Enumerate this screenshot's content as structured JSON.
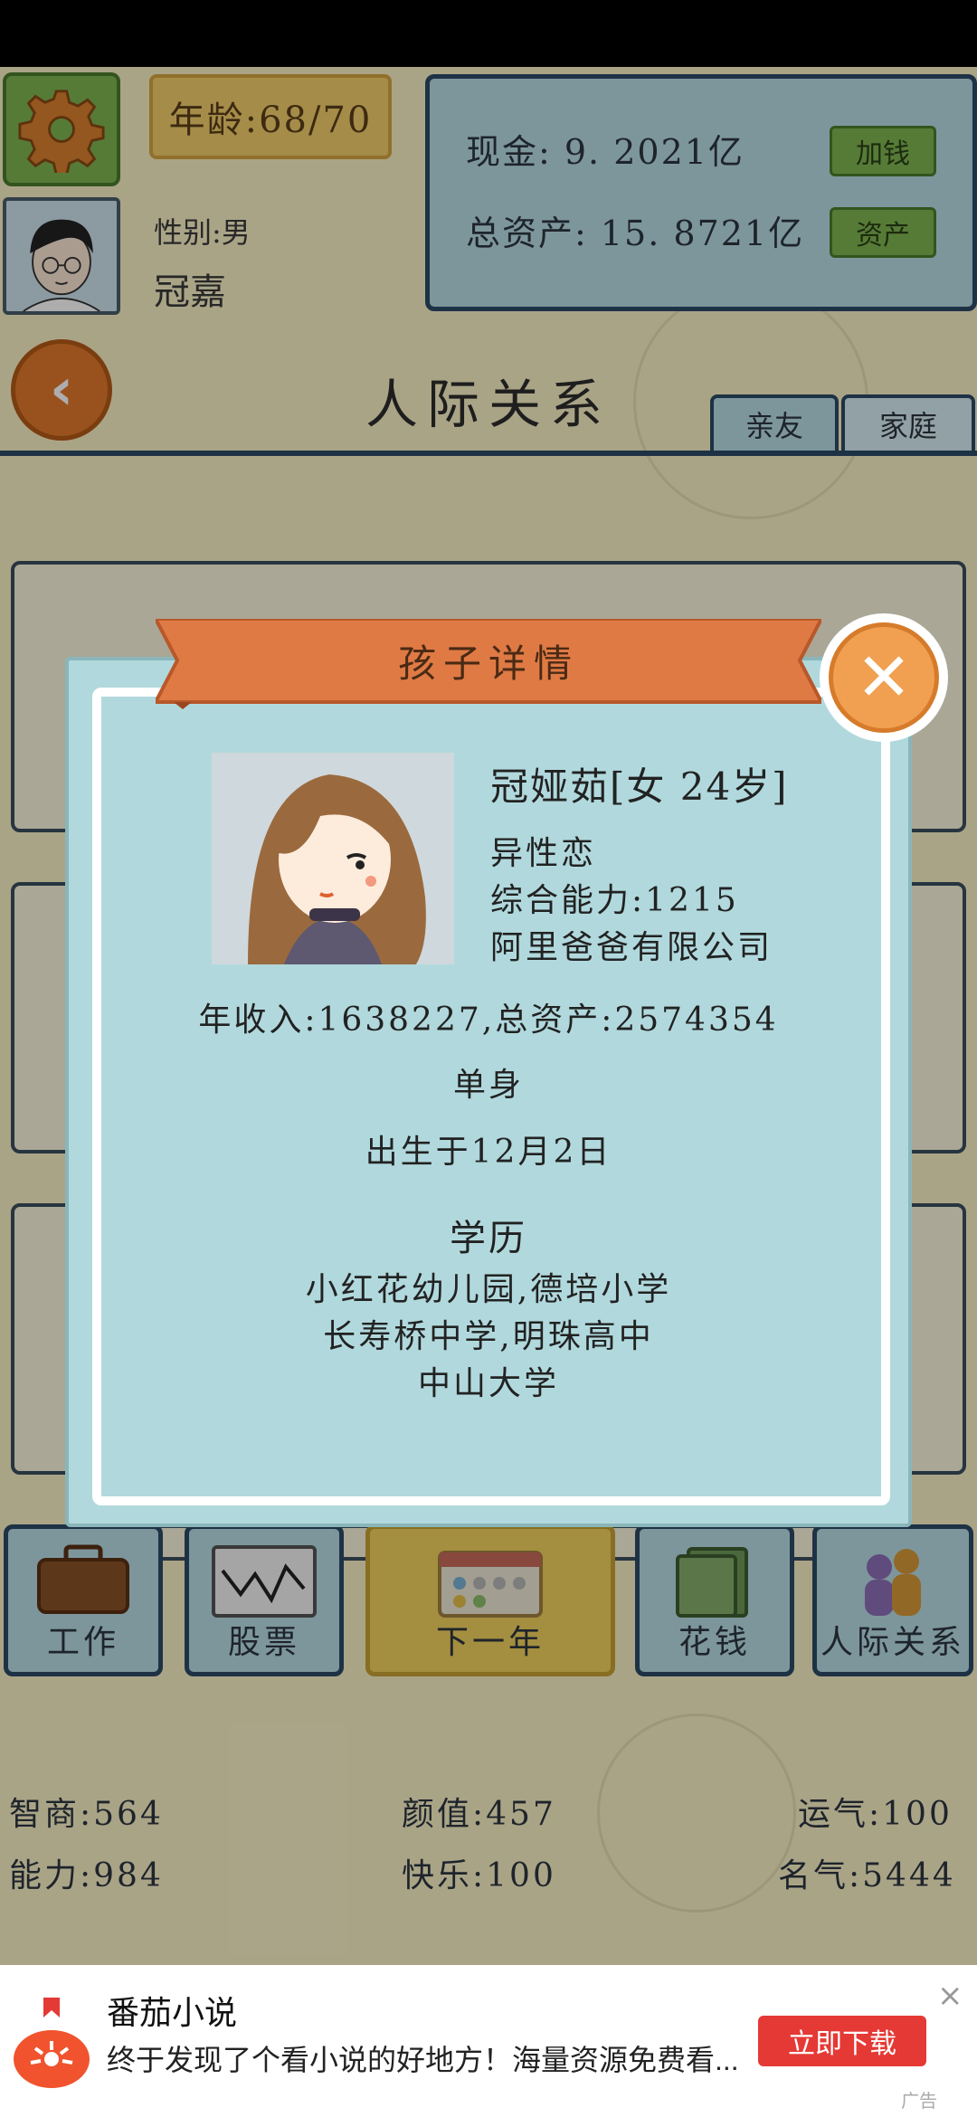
{
  "header": {
    "age_text": "年龄:68/70",
    "gender_text": "性别:男",
    "player_name": "冠嘉",
    "cash_text": "现金: 9. 2021亿",
    "add_money_label": "加钱",
    "assets_text": "总资产: 15. 8721亿",
    "assets_button_label": "资产"
  },
  "page": {
    "title": "人际关系",
    "tabs": [
      {
        "label": "亲友"
      },
      {
        "label": "家庭"
      }
    ]
  },
  "modal": {
    "title": "孩子详情",
    "child_name": "冠娅茹[女 24岁]",
    "orientation": "异性恋",
    "ability": "综合能力:1215",
    "company": "阿里爸爸有限公司",
    "finance": "年收入:1638227,总资产:2574354",
    "marital_status": "单身",
    "birthday": "出生于12月2日",
    "education_title": "学历",
    "education_lines": [
      "小红花幼儿园,德培小学",
      "长寿桥中学,明珠高中",
      "中山大学"
    ]
  },
  "menu": [
    {
      "label": "工作"
    },
    {
      "label": "股票"
    },
    {
      "label": "下一年"
    },
    {
      "label": "花钱"
    },
    {
      "label": "人际关系"
    }
  ],
  "stats": {
    "iq": "智商:564",
    "looks": "颜值:457",
    "luck": "运气:100",
    "ability": "能力:984",
    "happiness": "快乐:100",
    "fame": "名气:5444"
  },
  "ad": {
    "app_name": "番茄小说",
    "description": "终于发现了个看小说的好地方！海量资源免费看...",
    "button_label": "立即下载",
    "ad_mark": "广告",
    "close_glyph": "×"
  },
  "colors": {
    "background": "#fbf2c8",
    "panel_blue": "#b9dde6",
    "border_navy": "#2d4b66",
    "ribbon_orange": "#e07a45",
    "close_orange": "#f0a050",
    "ad_red": "#e53935"
  }
}
